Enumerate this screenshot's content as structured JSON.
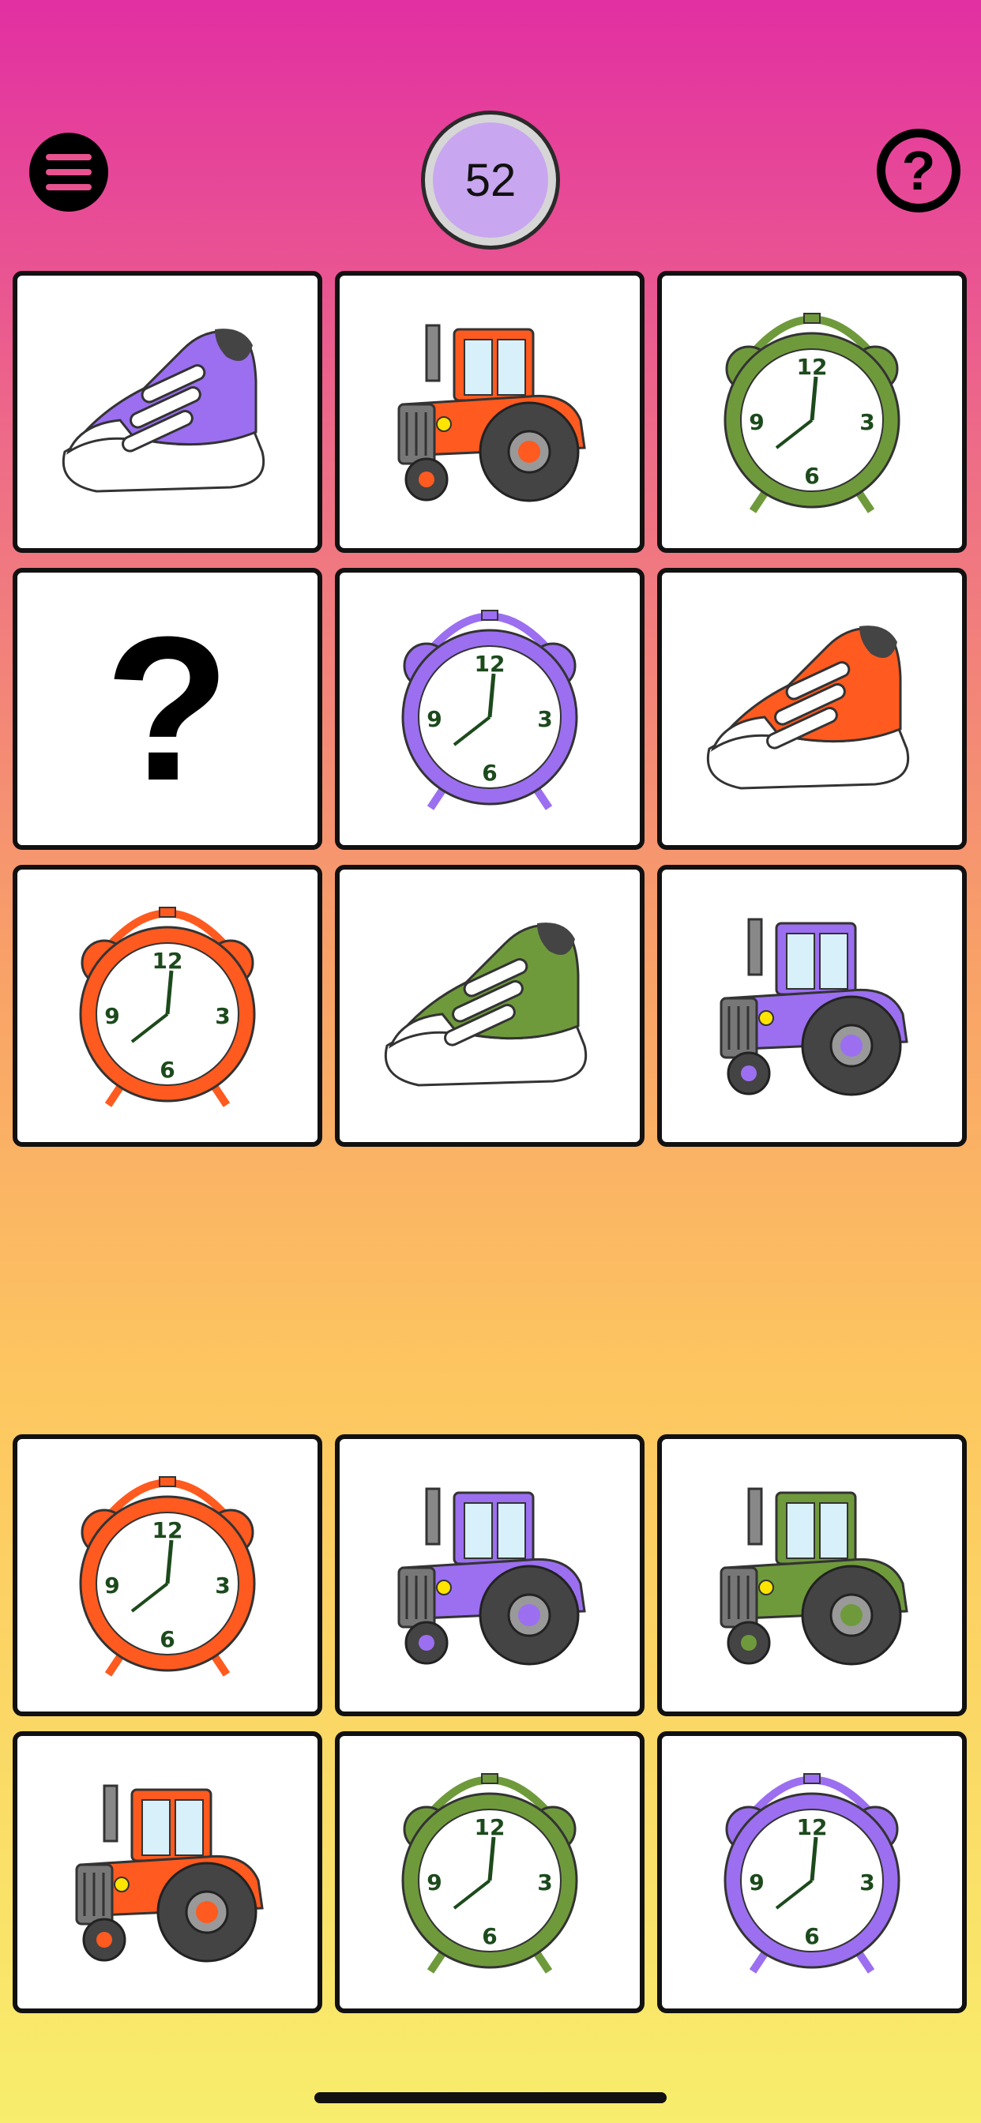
{
  "header": {
    "score": "52",
    "menu_icon": "hamburger-menu-icon",
    "help_icon": "question-mark-icon"
  },
  "colors": {
    "purple": "#9b6ff0",
    "orange": "#ff5a1f",
    "green": "#6f9a3c",
    "score_fill": "#c9a6f0"
  },
  "board": {
    "cards": [
      {
        "item": "shoe",
        "color": "purple"
      },
      {
        "item": "tractor",
        "color": "orange"
      },
      {
        "item": "clock",
        "color": "green"
      },
      {
        "item": "unknown",
        "label": "?"
      },
      {
        "item": "clock",
        "color": "purple"
      },
      {
        "item": "shoe",
        "color": "orange"
      },
      {
        "item": "clock",
        "color": "orange"
      },
      {
        "item": "shoe",
        "color": "green"
      },
      {
        "item": "tractor",
        "color": "purple"
      }
    ]
  },
  "choices": {
    "cards": [
      {
        "item": "clock",
        "color": "orange"
      },
      {
        "item": "tractor",
        "color": "purple"
      },
      {
        "item": "tractor",
        "color": "green"
      },
      {
        "item": "tractor",
        "color": "orange"
      },
      {
        "item": "clock",
        "color": "green"
      },
      {
        "item": "clock",
        "color": "purple"
      }
    ]
  },
  "clock_numbers": {
    "n12": "12",
    "n3": "3",
    "n6": "6",
    "n9": "9"
  }
}
